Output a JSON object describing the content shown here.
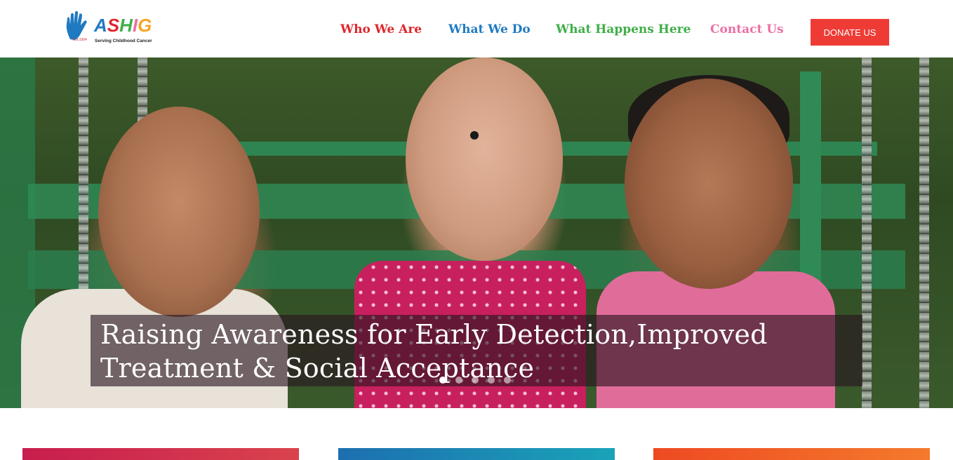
{
  "logo": {
    "word": "ASHIG",
    "est": "Est.1994",
    "tagline": "Serving Childhood Cancer",
    "letter_colors": [
      "#1f7ac1",
      "#e0262d",
      "#3fae49",
      "#ec6fa4",
      "#f5a623"
    ]
  },
  "nav": {
    "items": [
      {
        "label": "Who We Are",
        "color": "#e0262d"
      },
      {
        "label": "What We Do",
        "color": "#1f7ac1"
      },
      {
        "label": "What Happens Here",
        "color": "#3fae49"
      },
      {
        "label": "Contact Us",
        "color": "#ec6fa4"
      }
    ],
    "donate_label": "DONATE US"
  },
  "hero": {
    "caption": "Raising Awareness for Early Detection,Improved Treatment & Social Acceptance",
    "slide_count": 5,
    "active_slide": 1
  },
  "cards": {
    "colors": [
      "#c81d4e",
      "#1d6fb0",
      "#ee4a22"
    ]
  },
  "colors": {
    "donate_bg": "#ee3b36"
  }
}
